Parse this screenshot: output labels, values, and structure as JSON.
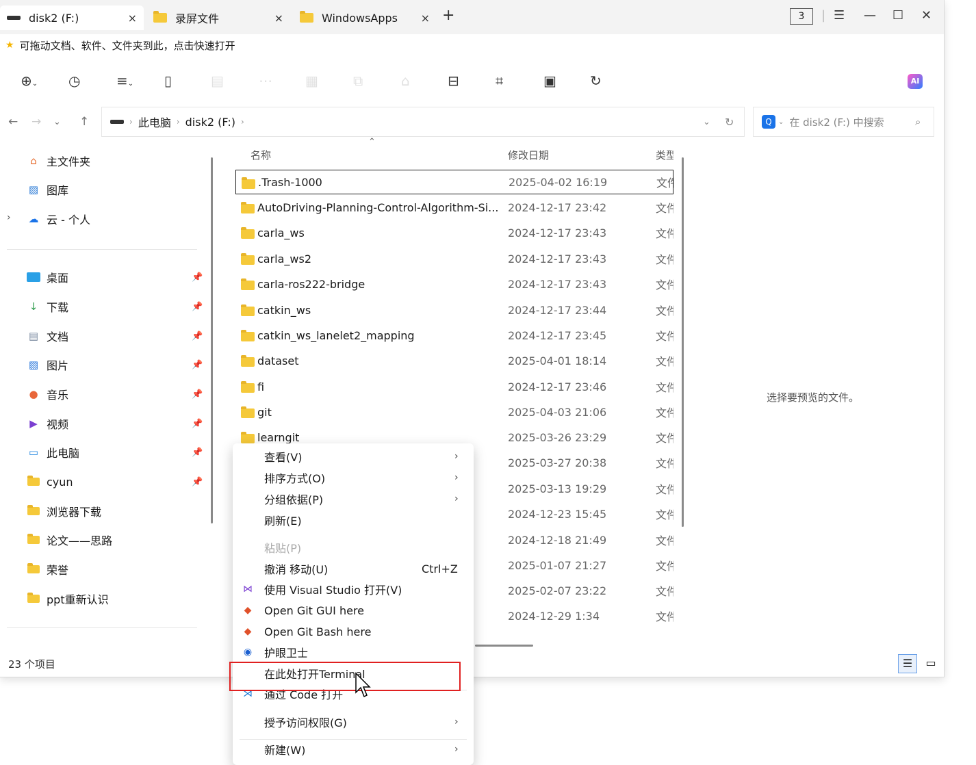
{
  "tabs": [
    {
      "label": "disk2 (F:)",
      "close": "×",
      "icon": "drive-icon"
    },
    {
      "label": "录屏文件",
      "close": "×",
      "icon": "folder-icon"
    },
    {
      "label": "WindowsApps",
      "close": "×",
      "icon": "folder-icon"
    }
  ],
  "new_tab": "+",
  "window_count": "3",
  "window_controls": {
    "menu": "☰",
    "minimize": "—",
    "maximize": "☐",
    "close": "✕"
  },
  "hint": "可拖动文档、软件、文件夹到此，点击快速打开",
  "toolbar": {
    "ai_label": "AI"
  },
  "address": {
    "root": "此电脑",
    "drive": "disk2 (F:)"
  },
  "search": {
    "placeholder": "在 disk2 (F:) 中搜索"
  },
  "sidebar": {
    "top_items": [
      {
        "label": "主文件夹",
        "icon": "home-icon"
      },
      {
        "label": "图库",
        "icon": "gallery-icon"
      },
      {
        "label": "云 - 个人",
        "icon": "cloud-icon"
      }
    ],
    "pinned": [
      {
        "label": "桌面",
        "icon": "desktop-icon"
      },
      {
        "label": "下载",
        "icon": "download-icon"
      },
      {
        "label": "文档",
        "icon": "document-icon"
      },
      {
        "label": "图片",
        "icon": "pictures-icon"
      },
      {
        "label": "音乐",
        "icon": "music-icon"
      },
      {
        "label": "视频",
        "icon": "video-icon"
      },
      {
        "label": "此电脑",
        "icon": "computer-icon"
      },
      {
        "label": "cyun",
        "icon": "folder-icon"
      },
      {
        "label": "浏览器下载",
        "icon": "folder-icon"
      },
      {
        "label": "论文——思路",
        "icon": "folder-icon"
      },
      {
        "label": "荣誉",
        "icon": "folder-icon"
      },
      {
        "label": "ppt重新认识",
        "icon": "folder-icon"
      }
    ]
  },
  "columns": {
    "name": "名称",
    "date": "修改日期",
    "type": "类型"
  },
  "files": [
    {
      "name": ".Trash-1000",
      "date": "2025-04-02 16:19",
      "type": "文件"
    },
    {
      "name": "AutoDriving-Planning-Control-Algorithm-Si...",
      "date": "2024-12-17 23:42",
      "type": "文件"
    },
    {
      "name": "carla_ws",
      "date": "2024-12-17 23:43",
      "type": "文件"
    },
    {
      "name": "carla_ws2",
      "date": "2024-12-17 23:43",
      "type": "文件"
    },
    {
      "name": "carla-ros222-bridge",
      "date": "2024-12-17 23:43",
      "type": "文件"
    },
    {
      "name": "catkin_ws",
      "date": "2024-12-17 23:44",
      "type": "文件"
    },
    {
      "name": "catkin_ws_lanelet2_mapping",
      "date": "2024-12-17 23:45",
      "type": "文件"
    },
    {
      "name": "dataset",
      "date": "2025-04-01 18:14",
      "type": "文件"
    },
    {
      "name": "fi",
      "date": "2024-12-17 23:46",
      "type": "文件"
    },
    {
      "name": "git",
      "date": "2025-04-03 21:06",
      "type": "文件"
    },
    {
      "name": "learngit",
      "date": "2025-03-26 23:29",
      "type": "文件"
    },
    {
      "name": "",
      "date": "2025-03-27 20:38",
      "type": "文件"
    },
    {
      "name": "",
      "date": "2025-03-13 19:29",
      "type": "文件"
    },
    {
      "name": "",
      "date": "2024-12-23 15:45",
      "type": "文件"
    },
    {
      "name": "",
      "date": "2024-12-18 21:49",
      "type": "文件"
    },
    {
      "name": "",
      "date": "2025-01-07 21:27",
      "type": "文件"
    },
    {
      "name": "",
      "date": "2025-02-07 23:22",
      "type": "文件"
    },
    {
      "name": "",
      "date": "2024-12-29 1:34",
      "type": "文件"
    }
  ],
  "preview": "选择要预览的文件。",
  "status": "23 个项目",
  "context_menu": [
    {
      "label": "查看(V)",
      "submenu": true
    },
    {
      "label": "排序方式(O)",
      "submenu": true
    },
    {
      "label": "分组依据(P)",
      "submenu": true
    },
    {
      "label": "刷新(E)"
    },
    {
      "label": "粘贴(P)",
      "disabled": true
    },
    {
      "label": "撤消 移动(U)",
      "accel": "Ctrl+Z"
    },
    {
      "label": "使用 Visual Studio 打开(V)",
      "icon": "visual-studio-icon"
    },
    {
      "label": "Open Git GUI here",
      "icon": "git-icon"
    },
    {
      "label": "Open Git Bash here",
      "icon": "git-icon"
    },
    {
      "label": "护眼卫士",
      "icon": "eye-guard-icon"
    },
    {
      "label": "在此处打开Terminal"
    },
    {
      "label": "通过 Code 打开",
      "icon": "vscode-icon"
    },
    {
      "label": "授予访问权限(G)",
      "submenu": true
    },
    {
      "label": "新建(W)",
      "submenu": true
    }
  ],
  "submenu_arrow": "›"
}
